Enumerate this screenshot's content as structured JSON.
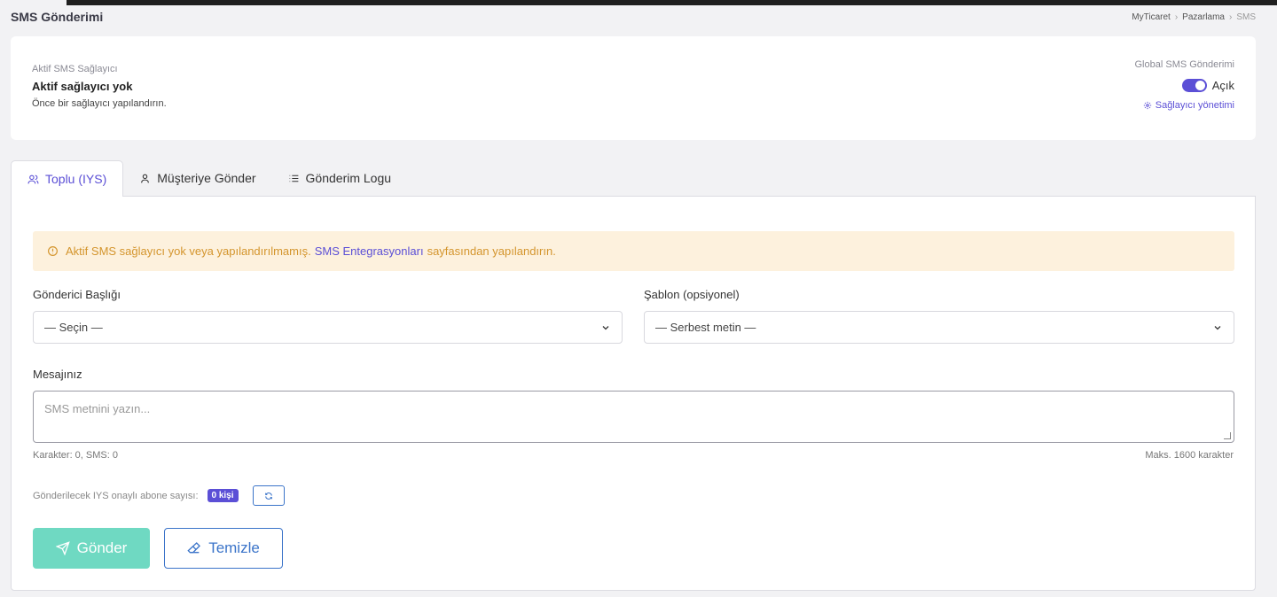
{
  "header": {
    "title": "SMS Gönderimi",
    "breadcrumb": [
      "MyTicaret",
      "Pazarlama",
      "SMS"
    ]
  },
  "provider": {
    "label": "Aktif SMS Sağlayıcı",
    "value": "Aktif sağlayıcı yok",
    "hint": "Önce bir sağlayıcı yapılandırın.",
    "global_label": "Global SMS Gönderimi",
    "toggle_label": "Açık",
    "toggle_on": true,
    "manage_link": "Sağlayıcı yönetimi"
  },
  "tabs": [
    {
      "label": "Toplu (IYS)",
      "icon": "users-icon",
      "active": true
    },
    {
      "label": "Müşteriye Gönder",
      "icon": "user-icon",
      "active": false
    },
    {
      "label": "Gönderim Logu",
      "icon": "list-icon",
      "active": false
    }
  ],
  "alert": {
    "text_before": "Aktif SMS sağlayıcı yok veya yapılandırılmamış.",
    "link": "SMS Entegrasyonları",
    "text_after": "sayfasından yapılandırın."
  },
  "form": {
    "sender_label": "Gönderici Başlığı",
    "sender_value": "— Seçin —",
    "template_label": "Şablon (opsiyonel)",
    "template_value": "— Serbest metin —",
    "message_label": "Mesajınız",
    "message_placeholder": "SMS metnini yazın...",
    "counter": "Karakter: 0, SMS: 0",
    "max_chars": "Maks. 1600 karakter",
    "subscriber_label": "Gönderilecek IYS onaylı abone sayısı:",
    "subscriber_count": "0 kişi"
  },
  "actions": {
    "send": "Gönder",
    "clear": "Temizle"
  },
  "colors": {
    "accent": "#5b4fd6",
    "send_button": "#6fd9c2",
    "outline_button": "#3b74c9",
    "alert_bg": "#fdf1dd",
    "alert_text": "#d4952d"
  }
}
